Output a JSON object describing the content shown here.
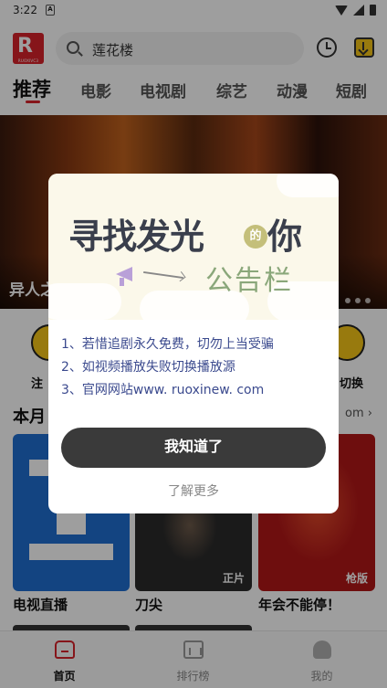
{
  "status_bar": {
    "time": "3:22",
    "notification_glyph": "A"
  },
  "header": {
    "logo_letter": "R",
    "logo_sub": "RUOXIVC3",
    "search_text": "莲花楼"
  },
  "tabs": [
    {
      "label": "推荐",
      "active": true
    },
    {
      "label": "电影"
    },
    {
      "label": "电视剧"
    },
    {
      "label": "综艺"
    },
    {
      "label": "动漫"
    },
    {
      "label": "短剧"
    }
  ],
  "banner": {
    "caption": "异人之"
  },
  "quick_entries": {
    "left_label": "注",
    "right_label": "切换"
  },
  "section": {
    "title": "本月",
    "more": "om"
  },
  "cards": [
    {
      "title": "电视直播",
      "badge": ""
    },
    {
      "title": "刀尖",
      "badge": "正片"
    },
    {
      "title": "年会不能停！",
      "badge": "枪版"
    }
  ],
  "bottom_nav": [
    {
      "label": "首页",
      "active": true
    },
    {
      "label": "排行榜"
    },
    {
      "label": "我的"
    }
  ],
  "dialog": {
    "heading_a": "寻找发光",
    "heading_de": "的",
    "heading_b": "你",
    "subtitle": "公告栏",
    "notices": [
      "1、若惜追剧永久免费，切勿上当受骗",
      "2、如视频播放失败切换播放源",
      "3、官网网站www. ruoxinew. com"
    ],
    "confirm_label": "我知道了",
    "learn_more_label": "了解更多"
  },
  "colors": {
    "accent": "#d9232a",
    "button_dark": "#3a3a3a",
    "notice_text": "#3b4a8e"
  }
}
